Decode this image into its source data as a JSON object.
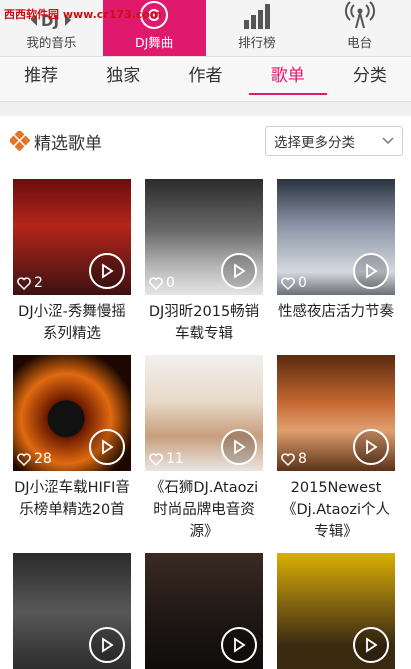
{
  "watermark": "西西软件园 www.cr173.com",
  "nav": {
    "items": [
      {
        "label": "我的音乐",
        "icon": "dj-logo-icon"
      },
      {
        "label": "DJ舞曲",
        "icon": "disc-icon"
      },
      {
        "label": "排行榜",
        "icon": "bar-chart-icon"
      },
      {
        "label": "电台",
        "icon": "radio-tower-icon"
      }
    ],
    "active_index": 1
  },
  "tabs": {
    "items": [
      "推荐",
      "独家",
      "作者",
      "歌单",
      "分类"
    ],
    "active_index": 3
  },
  "section": {
    "title": "精选歌单",
    "dropdown_label": "选择更多分类"
  },
  "colors": {
    "accent": "#e0196d",
    "diamond": "#e0762b"
  },
  "playlists": [
    {
      "title": "DJ小涩-秀舞慢摇系列精选",
      "count": "2"
    },
    {
      "title": "DJ羽昕2015畅销车载专辑",
      "count": "0"
    },
    {
      "title": "性感夜店活力节奏",
      "count": "0"
    },
    {
      "title": "DJ小涩车载HIFI音乐榜单精选20首",
      "count": "28"
    },
    {
      "title": "《石狮DJ.Ataozi时尚品牌电音资源》",
      "count": "11"
    },
    {
      "title": "2015Newest《Dj.Ataozi个人专辑》",
      "count": "8"
    },
    {
      "title": "",
      "count": ""
    },
    {
      "title": "",
      "count": ""
    },
    {
      "title": "",
      "count": ""
    }
  ]
}
